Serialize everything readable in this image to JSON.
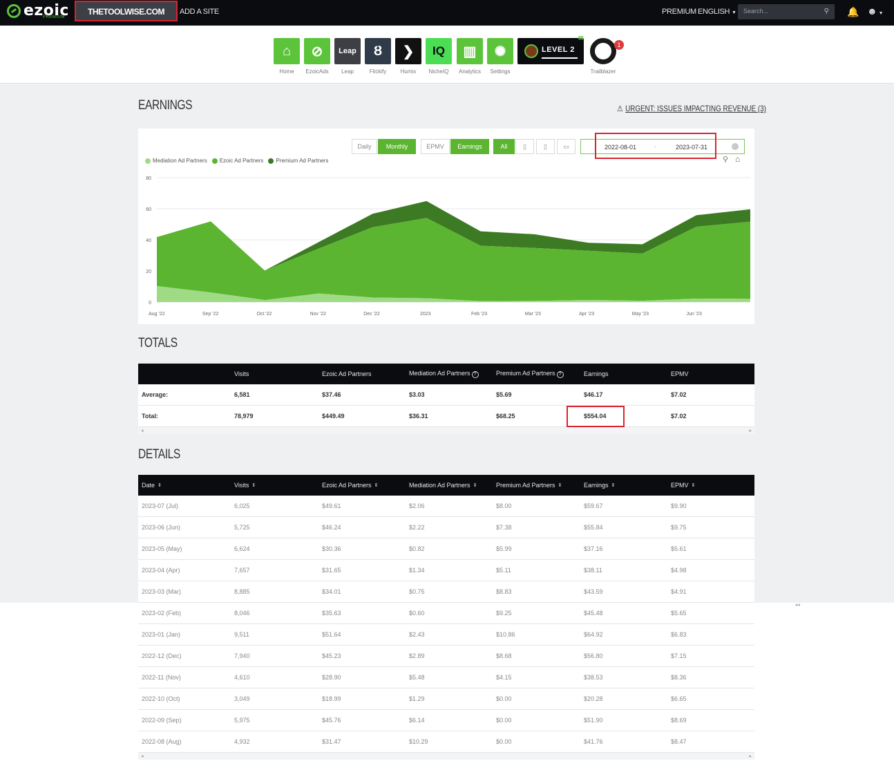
{
  "topbar": {
    "logo_text": "ezoic",
    "logo_sub": "PREMIUM",
    "site_name": "THETOOLWISE.COM",
    "add_site": "ADD A SITE",
    "premium": "PREMIUM",
    "language": "ENGLISH",
    "search_placeholder": "Search...",
    "icons": [
      "search-icon",
      "bell-icon",
      "user-icon"
    ]
  },
  "apps": [
    {
      "label": "Home",
      "icon": "home-icon",
      "color": "#5cc43b",
      "glyph": "⌂"
    },
    {
      "label": "EzoicAds",
      "icon": "ezoic-ads-icon",
      "color": "#5cc43b",
      "glyph": "⊘"
    },
    {
      "label": "Leap",
      "icon": "leap-icon",
      "color": "#3d3f44",
      "glyph": "Leap"
    },
    {
      "label": "Flickify",
      "icon": "flickify-icon",
      "color": "#2f3b48",
      "glyph": "Ȣ"
    },
    {
      "label": "Humix",
      "icon": "humix-icon",
      "color": "#111111",
      "glyph": "❯"
    },
    {
      "label": "NicheIQ",
      "icon": "nicheiq-icon",
      "color": "#4ddd55",
      "glyph": "IQ"
    },
    {
      "label": "Analytics",
      "icon": "analytics-icon",
      "color": "#5cc43b",
      "glyph": "▥"
    },
    {
      "label": "Settings",
      "icon": "settings-icon",
      "color": "#5cc43b",
      "glyph": "✺"
    }
  ],
  "level_badge": "LEVEL 2",
  "trailblazer": {
    "label": "Trailblazer",
    "badge": "1"
  },
  "earnings": {
    "title": "EARNINGS",
    "urgent": "URGENT: ISSUES IMPACTING REVENUE (3)",
    "controls": {
      "daily": "Daily",
      "monthly": "Monthly",
      "epmv": "EPMV",
      "earnings": "Earnings",
      "all": "All"
    },
    "date_start": "2022-08-01",
    "date_sep": "-",
    "date_end": "2023-07-31"
  },
  "chart_data": {
    "type": "area",
    "stacked": true,
    "categories": [
      "Aug '22",
      "Sep '22",
      "Oct '22",
      "Nov '22",
      "Dec '22",
      "2023",
      "Feb '23",
      "Mar '23",
      "Apr '23",
      "May '23",
      "Jun '23",
      "Jul '23"
    ],
    "x_tick_labels": [
      "Aug '22",
      "Sep '22",
      "Oct '22",
      "Nov '22",
      "Dec '22",
      "2023",
      "Feb '23",
      "Mar '23",
      "Apr '23",
      "May '23",
      "Jun '23"
    ],
    "series": [
      {
        "name": "Mediation Ad Partners",
        "color": "#9fdb85",
        "values": [
          10.29,
          6.14,
          1.29,
          5.48,
          2.89,
          2.43,
          0.6,
          0.75,
          1.34,
          0.82,
          2.22,
          2.06
        ]
      },
      {
        "name": "Ezoic Ad Partners",
        "color": "#5cb531",
        "values": [
          31.47,
          45.76,
          18.99,
          28.9,
          45.23,
          51.64,
          35.63,
          34.01,
          31.65,
          30.36,
          46.24,
          49.61
        ]
      },
      {
        "name": "Premium Ad Partners",
        "color": "#3d7a24",
        "values": [
          0.0,
          0.0,
          0.0,
          4.15,
          8.68,
          10.86,
          9.25,
          8.83,
          5.11,
          5.99,
          7.38,
          8.0
        ]
      }
    ],
    "ylim": [
      0,
      80
    ],
    "yticks": [
      0,
      20,
      40,
      60,
      80
    ],
    "grid": true,
    "legend": "top-left"
  },
  "totals": {
    "title": "TOTALS",
    "columns": [
      "",
      "Visits",
      "Ezoic Ad Partners",
      "Mediation Ad Partners",
      "Premium Ad Partners",
      "Earnings",
      "EPMV"
    ],
    "rows": [
      [
        "Average:",
        "6,581",
        "$37.46",
        "$3.03",
        "$5.69",
        "$46.17",
        "$7.02"
      ],
      [
        "Total:",
        "78,979",
        "$449.49",
        "$36.31",
        "$68.25",
        "$554.04",
        "$7.02"
      ]
    ]
  },
  "details": {
    "title": "DETAILS",
    "columns": [
      "Date",
      "Visits",
      "Ezoic Ad Partners",
      "Mediation Ad Partners",
      "Premium Ad Partners",
      "Earnings",
      "EPMV"
    ],
    "rows": [
      [
        "2023-07 (Jul)",
        "6,025",
        "$49.61",
        "$2.06",
        "$8.00",
        "$59.67",
        "$9.90"
      ],
      [
        "2023-06 (Jun)",
        "5,725",
        "$46.24",
        "$2.22",
        "$7.38",
        "$55.84",
        "$9.75"
      ],
      [
        "2023-05 (May)",
        "6,624",
        "$30.36",
        "$0.82",
        "$5.99",
        "$37.16",
        "$5.61"
      ],
      [
        "2023-04 (Apr)",
        "7,657",
        "$31.65",
        "$1.34",
        "$5.11",
        "$38.11",
        "$4.98"
      ],
      [
        "2023-03 (Mar)",
        "8,885",
        "$34.01",
        "$0.75",
        "$8.83",
        "$43.59",
        "$4.91"
      ],
      [
        "2023-02 (Feb)",
        "8,046",
        "$35.63",
        "$0.60",
        "$9.25",
        "$45.48",
        "$5.65"
      ],
      [
        "2023-01 (Jan)",
        "9,511",
        "$51.64",
        "$2.43",
        "$10.86",
        "$64.92",
        "$6.83"
      ],
      [
        "2022-12 (Dec)",
        "7,940",
        "$45.23",
        "$2.89",
        "$8.68",
        "$56.80",
        "$7.15"
      ],
      [
        "2022-11 (Nov)",
        "4,610",
        "$28.90",
        "$5.48",
        "$4.15",
        "$38.53",
        "$8.36"
      ],
      [
        "2022-10 (Oct)",
        "3,049",
        "$18.99",
        "$1.29",
        "$0.00",
        "$20.28",
        "$6.65"
      ],
      [
        "2022-09 (Sep)",
        "5,975",
        "$45.76",
        "$6.14",
        "$0.00",
        "$51.90",
        "$8.69"
      ],
      [
        "2022-08 (Aug)",
        "4,932",
        "$31.47",
        "$10.29",
        "$0.00",
        "$41.76",
        "$8.47"
      ]
    ]
  }
}
